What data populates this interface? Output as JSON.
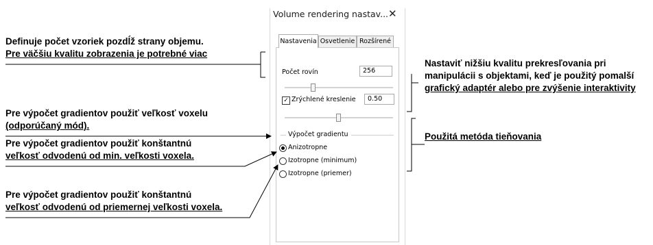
{
  "dialog": {
    "title": "Volume rendering nastav...",
    "close_glyph": "✕",
    "tabs": [
      "Nastavenia",
      "Osvetlenie",
      "Rozšírené"
    ],
    "planes_label": "Počet rovín",
    "planes_value": "256",
    "accel_label": "Zrýchlené kreslenie",
    "accel_checked": "✓",
    "accel_value": "0.50",
    "gradient_group": "Výpočet gradientu",
    "radio_options": [
      "Anizotropne",
      "Izotropne (minimum)",
      "Izotropne (priemer)"
    ]
  },
  "annotations": {
    "samples": [
      "Definuje počet vzoriek pozdĺž strany objemu.",
      "Pre väčšiu kvalitu zobrazenia je potrebné viac"
    ],
    "voxel_size": [
      "Pre výpočet gradientov použiť veľkosť voxelu",
      "(odporúčaný mód)."
    ],
    "min_size": [
      "Pre výpočet gradientov použiť konštantnú",
      "veľkosť odvodenú od min. veľkosti voxela."
    ],
    "avg_size": [
      "Pre výpočet gradientov použiť konštantnú",
      "veľkosť odvodenú od priemernej veľkosti voxela."
    ],
    "lower_quality": [
      "Nastaviť nižšiu kvalitu prekresľovania pri",
      "manipulácii s objektami, keď je použitý pomalší",
      "grafický adaptér alebo pre zvýšenie interaktivity"
    ],
    "shading": "Použitá metóda tieňovania"
  }
}
